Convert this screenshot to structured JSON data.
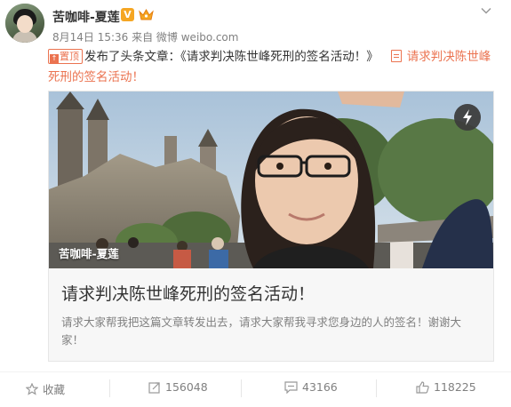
{
  "post": {
    "author": "苦咖啡-夏莲",
    "badges": {
      "vip": "V"
    },
    "meta": "8月14日 15:36 来自 微博 weibo.com",
    "pin_label": "置顶",
    "text_prefix": "发布了头条文章：《请求判决陈世峰死刑的签名活动！》",
    "link_text": "请求判决陈世峰死刑的签名活动！"
  },
  "article": {
    "image_author": "苦咖啡-夏莲",
    "title": "请求判决陈世峰死刑的签名活动！",
    "summary": "请求大家帮我把这篇文章转发出去，请求大家帮我寻求您身边的人的签名！谢谢大家！"
  },
  "actions": {
    "favorite_label": "收藏",
    "repost_count": "156048",
    "comment_count": "43166",
    "like_count": "118225"
  },
  "colors": {
    "accent": "#eb7350",
    "muted": "#808080",
    "text": "#333333",
    "vip": "#f5a623"
  },
  "icons": [
    "chevron-down-icon",
    "pin-icon",
    "document-icon",
    "flash-icon",
    "star-icon",
    "repost-icon",
    "comment-icon",
    "thumbs-up-icon"
  ]
}
